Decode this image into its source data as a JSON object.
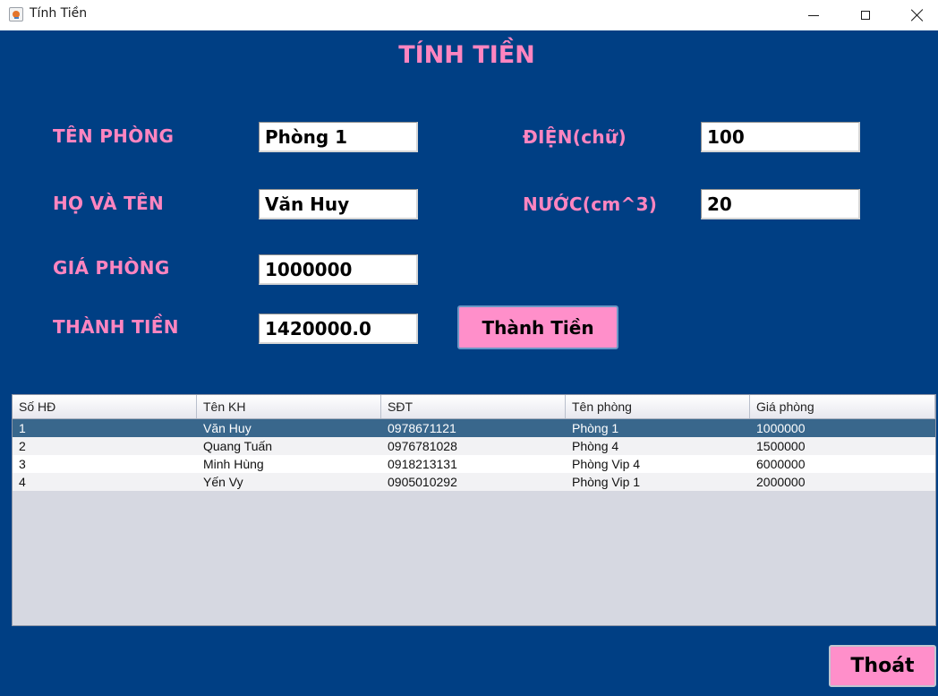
{
  "window": {
    "title": "Tính Tiền"
  },
  "form": {
    "heading": "TÍNH TIỀN",
    "ten_phong_label": "TÊN PHÒNG",
    "ten_phong_value": "Phòng 1",
    "ho_ten_label": "HỌ VÀ TÊN",
    "ho_ten_value": "Văn Huy",
    "gia_phong_label": "GIÁ PHÒNG",
    "gia_phong_value": "1000000",
    "thanh_tien_label": "THÀNH TIỀN",
    "thanh_tien_value": "1420000.0",
    "dien_label": "ĐIỆN(chữ)",
    "dien_value": "100",
    "nuoc_label": "NƯỚC(cm^3)",
    "nuoc_value": "20",
    "calc_button": "Thành Tiền"
  },
  "table": {
    "columns": [
      "Số HĐ",
      "Tên KH",
      "SĐT",
      "Tên phòng",
      "Giá phòng"
    ],
    "rows": [
      [
        "1",
        "Văn Huy",
        "0978671121",
        "Phòng 1",
        "1000000"
      ],
      [
        "2",
        "Quang Tuấn",
        "0976781028",
        "Phòng 4",
        "1500000"
      ],
      [
        "3",
        "Minh Hùng",
        "0918213131",
        "Phòng Vip 4",
        "6000000"
      ],
      [
        "4",
        "Yến Vy",
        "0905010292",
        "Phòng Vip 1",
        "2000000"
      ]
    ]
  },
  "footer": {
    "exit_button": "Thoát"
  }
}
